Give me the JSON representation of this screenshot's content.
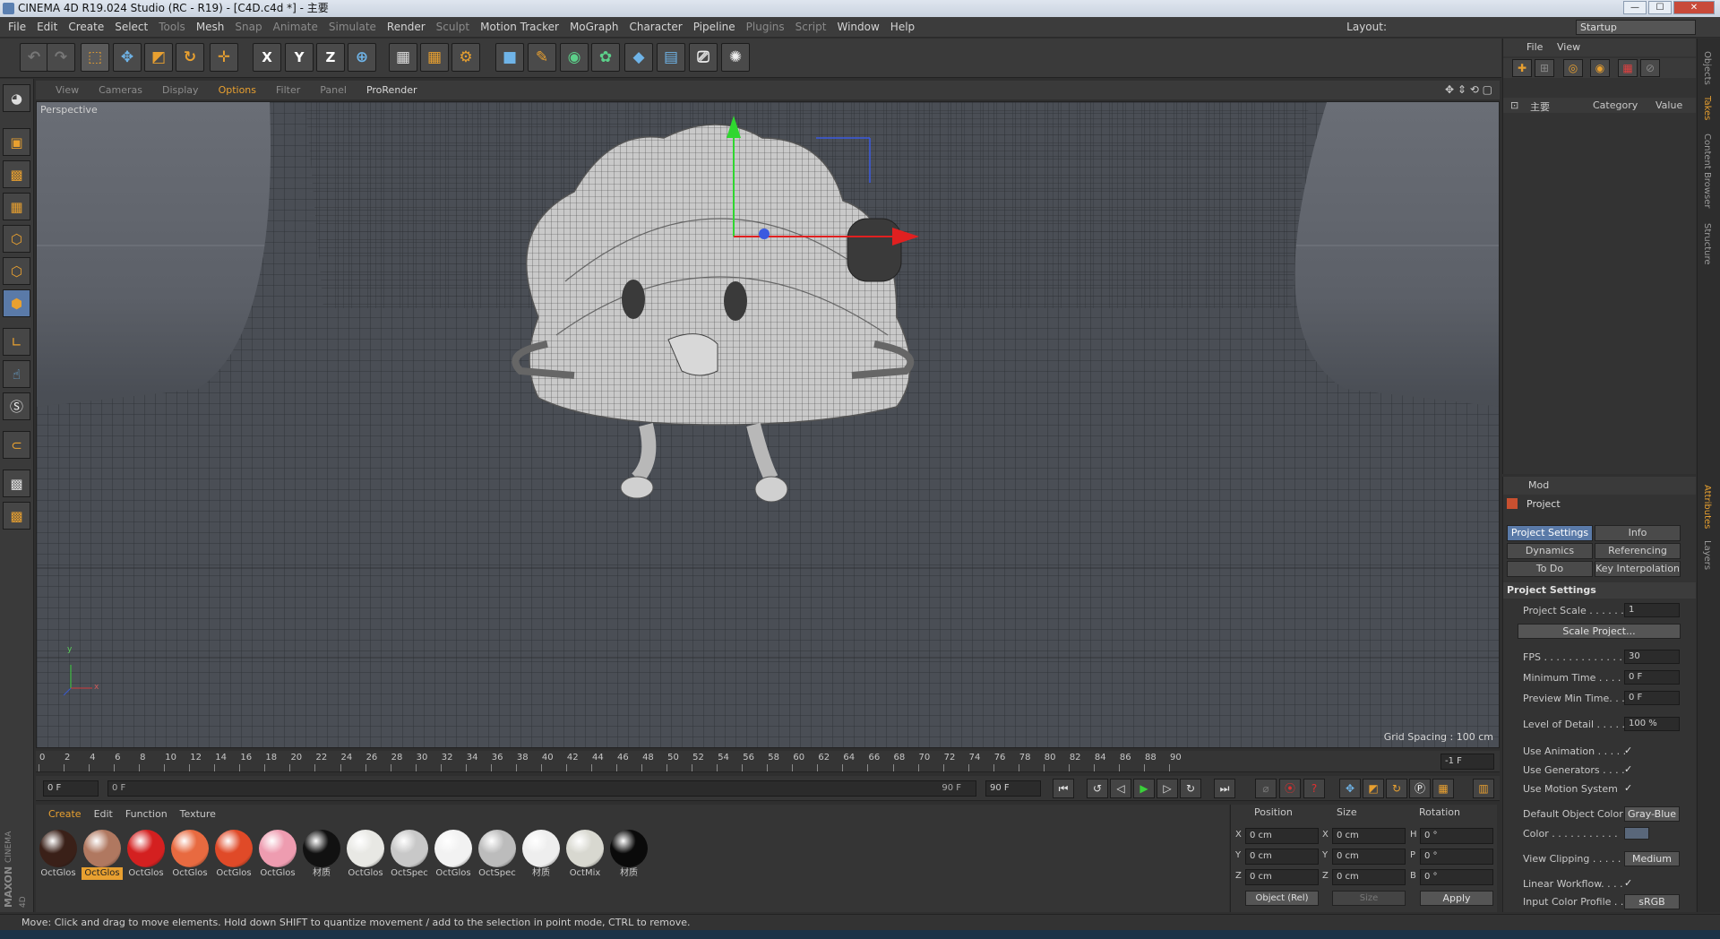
{
  "window": {
    "title": "CINEMA 4D R19.024 Studio (RC - R19) - [C4D.c4d *] - 主要",
    "minimize": "—",
    "maximize": "☐",
    "close": "✕"
  },
  "menubar": {
    "items": [
      "File",
      "Edit",
      "Create",
      "Select",
      "Tools",
      "Mesh",
      "Snap",
      "Animate",
      "Simulate",
      "Render",
      "Sculpt",
      "Motion Tracker",
      "MoGraph",
      "Character",
      "Pipeline",
      "Plugins",
      "Script",
      "Window",
      "Help"
    ],
    "layout_label": "Layout:",
    "layout_value": "Startup"
  },
  "toolbar": {
    "axis_x": "X",
    "axis_y": "Y",
    "axis_z": "Z"
  },
  "viewport_menu": {
    "items": [
      "View",
      "Cameras",
      "Display",
      "Options",
      "Filter",
      "Panel",
      "ProRender"
    ],
    "active": "Options"
  },
  "viewport": {
    "label": "Perspective",
    "grid_spacing": "Grid Spacing : 100 cm",
    "axis_x": "x",
    "axis_y": "y"
  },
  "timeline": {
    "ticks": [
      "0",
      "2",
      "4",
      "6",
      "8",
      "10",
      "12",
      "14",
      "16",
      "18",
      "20",
      "22",
      "24",
      "26",
      "28",
      "30",
      "32",
      "34",
      "36",
      "38",
      "40",
      "42",
      "44",
      "46",
      "48",
      "50",
      "52",
      "54",
      "56",
      "58",
      "60",
      "62",
      "64",
      "66",
      "68",
      "70",
      "72",
      "74",
      "76",
      "78",
      "80",
      "82",
      "84",
      "86",
      "88",
      "90"
    ],
    "current_frame": "-1 F"
  },
  "transport": {
    "start": "0 F",
    "slider_start": "0 F",
    "slider_end": "90 F",
    "end": "90 F"
  },
  "materials": {
    "menu": [
      "Create",
      "Edit",
      "Function",
      "Texture"
    ],
    "items": [
      {
        "name": "OctGlos",
        "color": "#3a2018",
        "selected": false
      },
      {
        "name": "OctGlos",
        "color": "#b07860",
        "selected": true
      },
      {
        "name": "OctGlos",
        "color": "#d42020",
        "selected": false
      },
      {
        "name": "OctGlos",
        "color": "#e86a40",
        "selected": false
      },
      {
        "name": "OctGlos",
        "color": "#e04a28",
        "selected": false
      },
      {
        "name": "OctGlos",
        "color": "#ee9cb0",
        "selected": false
      },
      {
        "name": "材质",
        "color": "#111111",
        "selected": false
      },
      {
        "name": "OctGlos",
        "color": "#e8e8e4",
        "selected": false
      },
      {
        "name": "OctSpec",
        "color": "#c8c8c8",
        "selected": false
      },
      {
        "name": "OctGlos",
        "color": "#f2f2f2",
        "selected": false
      },
      {
        "name": "OctSpec",
        "color": "#bcbcbc",
        "selected": false
      },
      {
        "name": "材质",
        "color": "#eeeeee",
        "selected": false
      },
      {
        "name": "OctMix",
        "color": "#d8d8d0",
        "selected": false
      },
      {
        "name": "材质",
        "color": "#0a0a0a",
        "selected": false
      }
    ]
  },
  "coords": {
    "position_hdr": "Position",
    "size_hdr": "Size",
    "rotation_hdr": "Rotation",
    "x_lbl": "X",
    "y_lbl": "Y",
    "z_lbl": "Z",
    "h_lbl": "H",
    "p_lbl": "P",
    "b_lbl": "B",
    "pos_x": "0 cm",
    "pos_y": "0 cm",
    "pos_z": "0 cm",
    "size_x": "0 cm",
    "size_y": "0 cm",
    "size_z": "0 cm",
    "rot_h": "0 °",
    "rot_p": "0 °",
    "rot_b": "0 °",
    "mode": "Object (Rel)",
    "size_mode": "Size",
    "apply": "Apply"
  },
  "object_manager": {
    "menu_file": "File",
    "menu_view": "View",
    "root_item": "主要",
    "col_category": "Category",
    "col_value": "Value"
  },
  "attributes": {
    "menu": "Mod",
    "object_title": "Project",
    "tabs": [
      {
        "label": "Project Settings",
        "active": true
      },
      {
        "label": "Info",
        "active": false
      },
      {
        "label": "Dynamics",
        "active": false
      },
      {
        "label": "Referencing",
        "active": false
      },
      {
        "label": "To Do",
        "active": false
      },
      {
        "label": "Key Interpolation",
        "active": false
      }
    ],
    "section": "Project Settings",
    "project_scale_label": "Project Scale . . . . . .",
    "project_scale": "1",
    "scale_project_btn": "Scale Project...",
    "fps_label": "FPS . . . . . . . . . . . . . .",
    "fps": "30",
    "min_time_label": "Minimum Time . . . . .",
    "min_time": "0 F",
    "preview_min_label": "Preview Min Time. . .",
    "preview_min": "0 F",
    "lod_label": "Level of Detail . . . . .",
    "lod": "100 %",
    "use_animation_label": "Use Animation . . . . .",
    "use_generators_label": "Use Generators . . . .",
    "use_motion_label": "Use Motion System",
    "default_color_label": "Default Object Color",
    "default_color": "Gray-Blue",
    "color_label": "Color . . . . . . . . . . .",
    "view_clipping_label": "View Clipping . . . . .",
    "view_clipping": "Medium",
    "linear_workflow_label": "Linear Workflow. . . .",
    "input_profile_label": "Input Color Profile . .",
    "input_profile": "sRGB",
    "check": "✓"
  },
  "side_tabs": [
    "Objects",
    "Takes",
    "Content Browser",
    "Structure",
    "Attributes",
    "Layers"
  ],
  "brand": {
    "maxon": "MAXON",
    "c4d": "CINEMA 4D"
  },
  "status": "Move: Click and drag to move elements. Hold down SHIFT to quantize movement / add to the selection in point mode, CTRL to remove."
}
